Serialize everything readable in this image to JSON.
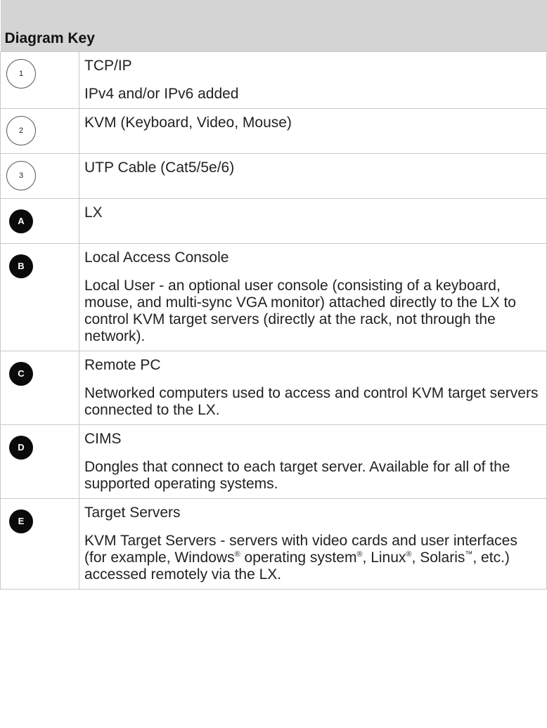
{
  "table": {
    "header": "Diagram Key",
    "rows": [
      {
        "marker": "1",
        "marker_style": "outline",
        "term": "TCP/IP",
        "desc": "IPv4 and/or IPv6 added"
      },
      {
        "marker": "2",
        "marker_style": "outline",
        "term": "KVM (Keyboard, Video, Mouse)",
        "desc": ""
      },
      {
        "marker": "3",
        "marker_style": "outline",
        "term": "UTP Cable (Cat5/5e/6)",
        "desc": ""
      },
      {
        "marker": "A",
        "marker_style": "solid",
        "term": "LX",
        "desc": ""
      },
      {
        "marker": "B",
        "marker_style": "solid",
        "term": "Local Access Console",
        "desc": "Local User - an optional user console (consisting of a keyboard, mouse, and multi-sync VGA monitor) attached directly to the LX to control KVM target servers (directly at the rack, not through the network)."
      },
      {
        "marker": "C",
        "marker_style": "solid",
        "term": "Remote PC",
        "desc": "Networked computers used to access and control KVM target servers connected to the LX."
      },
      {
        "marker": "D",
        "marker_style": "solid",
        "term": "CIMS",
        "desc": "Dongles that connect to each target server. Available for all of the supported operating systems."
      },
      {
        "marker": "E",
        "marker_style": "solid",
        "term": "Target Servers",
        "desc_parts": [
          "KVM Target Servers - servers with video cards and user interfaces (for example, Windows",
          "®",
          " operating system",
          "®",
          ", Linux",
          "®",
          ", Solaris",
          "™",
          ", etc.) accessed remotely via the LX."
        ]
      }
    ]
  },
  "colors": {
    "header_bg": "#d4d4d4",
    "border": "#c8c8c8",
    "badge_solid": "#0a0a0a"
  }
}
